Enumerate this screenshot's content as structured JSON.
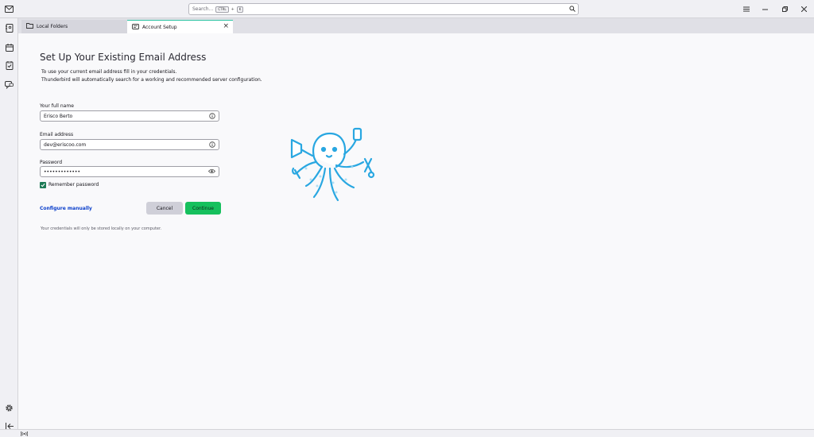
{
  "titlebar": {
    "search_placeholder": "Search...",
    "shortcut_ctrl": "CTRL",
    "shortcut_plus": "+",
    "shortcut_key": "K"
  },
  "tabs": [
    {
      "label": "Local Folders",
      "icon": "folder-icon",
      "active": false
    },
    {
      "label": "Account Setup",
      "icon": "account-card-icon",
      "active": true
    }
  ],
  "spaces": [
    "mail-icon",
    "address-book-icon",
    "calendar-icon",
    "tasks-icon",
    "chat-icon",
    "settings-icon",
    "collapse-icon"
  ],
  "form": {
    "heading": "Set Up Your Existing Email Address",
    "desc_line1": "To use your current email address fill in your credentials.",
    "desc_line2": "Thunderbird will automatically search for a working and recommended server configuration.",
    "name_label": "Your full name",
    "name_value": "Erisco Berto",
    "email_label": "Email address",
    "email_value": "dev@eriscoo.com",
    "password_label": "Password",
    "password_value": "•••••••••••••",
    "remember_label": "Remember password",
    "remember_checked": true,
    "configure_link": "Configure manually",
    "cancel_label": "Cancel",
    "continue_label": "Continue",
    "note": "Your credentials will only be stored locally on your computer."
  },
  "colors": {
    "accent": "#16c05d",
    "link": "#0b3fcb",
    "tab_highlight": "#2ac3a2",
    "mascot": "#29a7e1"
  }
}
